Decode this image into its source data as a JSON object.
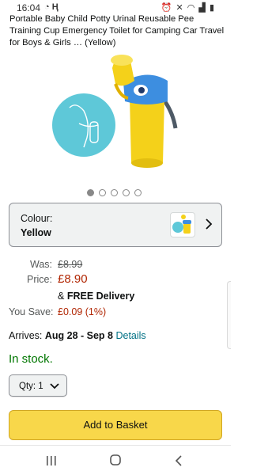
{
  "status_bar": {
    "time": "16:04",
    "left_icons": [
      "whatsapp-icon",
      "h-app-icon"
    ],
    "right_icons": [
      "alarm-icon",
      "mute-icon",
      "wifi-icon",
      "signal-icon",
      "battery-icon"
    ]
  },
  "product": {
    "title": "Portable Baby Child Potty Urinal Reusable Pee Training Cup Emergency Toilet for Camping Car Travel for Boys & Girls … (Yellow)",
    "image_icon": "potty-urinal-product-image",
    "carousel": {
      "count": 5,
      "active_index": 0
    }
  },
  "colour_selector": {
    "label": "Colour:",
    "value": "Yellow"
  },
  "pricing": {
    "was_label": "Was:",
    "was_value": "£8.99",
    "price_label": "Price:",
    "price_value": "£8.90",
    "delivery_prefix": "& ",
    "delivery_text": "FREE Delivery",
    "save_label": "You Save:",
    "save_value": "£0.09 (1%)"
  },
  "delivery_info": {
    "arrives_label": "Arrives: ",
    "arrives_dates": "Aug 28 - Sep 8",
    "details_link": "Details"
  },
  "availability": "In stock.",
  "quantity": {
    "label": "Qty: 1"
  },
  "add_to_basket": "Add to Basket",
  "colors": {
    "price_red": "#b12704",
    "stock_green": "#007600",
    "link_teal": "#007185",
    "basket_yellow": "#f8d74a"
  }
}
